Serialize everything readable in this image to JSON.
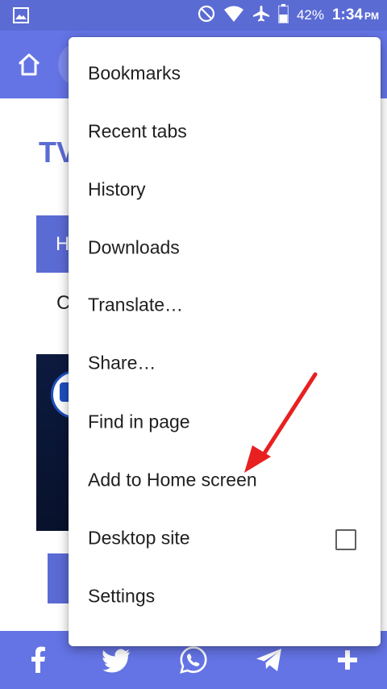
{
  "status_bar": {
    "battery_percent": "42%",
    "time": "1:34",
    "ampm": "PM",
    "icons": [
      "image-icon",
      "do-not-disturb-icon",
      "wifi-icon",
      "airplane-icon",
      "battery-icon"
    ]
  },
  "page": {
    "title_fragment": "TV",
    "block_letter": "H",
    "text_fragment": "C",
    "colors": {
      "primary": "#5b6bd4",
      "toolbar": "#6474e5"
    }
  },
  "menu": {
    "items": [
      {
        "label": "Bookmarks"
      },
      {
        "label": "Recent tabs"
      },
      {
        "label": "History"
      },
      {
        "label": "Downloads"
      },
      {
        "label": "Translate…"
      },
      {
        "label": "Share…"
      },
      {
        "label": "Find in page"
      },
      {
        "label": "Add to Home screen"
      },
      {
        "label": "Desktop site",
        "checkbox": false
      },
      {
        "label": "Settings"
      }
    ]
  },
  "share_bar": {
    "icons": [
      "facebook-icon",
      "twitter-icon",
      "whatsapp-icon",
      "telegram-icon",
      "plus-icon"
    ]
  },
  "annotation": {
    "arrow_color": "#e82020"
  }
}
